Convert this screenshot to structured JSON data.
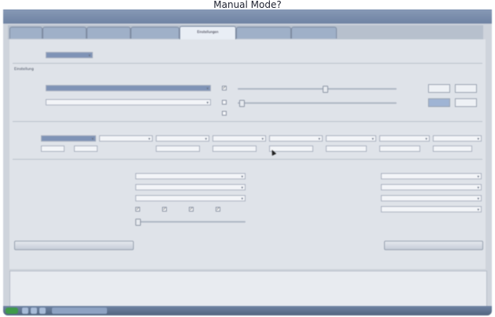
{
  "page_title": "Manual Mode?",
  "window": {
    "title": ""
  },
  "tabs": [
    {
      "label": "",
      "active": false
    },
    {
      "label": "",
      "active": false
    },
    {
      "label": "",
      "active": false
    },
    {
      "label": "",
      "active": false
    },
    {
      "label": "Einstellungen",
      "active": true
    },
    {
      "label": "",
      "active": false
    },
    {
      "label": "",
      "active": false
    }
  ],
  "general": {
    "section": "",
    "label": "",
    "value": ""
  },
  "settings": {
    "section": "Einstellung",
    "header_left": "",
    "header_check": "",
    "header_slider": "",
    "col1": "",
    "col2": "",
    "col3": "",
    "rows": [
      {
        "label": "",
        "value": "",
        "db": "",
        "v2": "",
        "v3": ""
      },
      {
        "label": "",
        "value": "",
        "db": "",
        "v2": "",
        "v3": ""
      }
    ],
    "all_label": ""
  },
  "alloc": {
    "section": "",
    "row1_label": "",
    "row2_label": "",
    "selects": [
      "",
      "",
      "",
      "",
      "",
      "",
      "",
      "",
      ""
    ],
    "inputs": [
      "",
      "",
      "",
      "",
      "",
      "",
      "",
      "",
      "",
      "",
      "",
      "",
      "",
      "",
      "",
      "",
      "",
      ""
    ]
  },
  "rf": {
    "section": "",
    "rows": [
      {
        "label": "",
        "value": ""
      },
      {
        "label": "",
        "value": ""
      },
      {
        "label": "",
        "value": ""
      },
      {
        "label": "",
        "value": ""
      },
      {
        "label": "",
        "value": ""
      }
    ]
  },
  "right_panel": {
    "section": "",
    "rows": [
      {
        "label": "",
        "value": ""
      },
      {
        "label": "",
        "value": ""
      },
      {
        "label": "",
        "value": ""
      },
      {
        "label": "",
        "value": ""
      }
    ]
  },
  "buttons": {
    "left": "",
    "right": ""
  },
  "log": [
    "",
    "",
    "",
    "",
    "",
    "",
    ""
  ],
  "taskbar": {
    "start": "",
    "task": "",
    "tray": ""
  }
}
